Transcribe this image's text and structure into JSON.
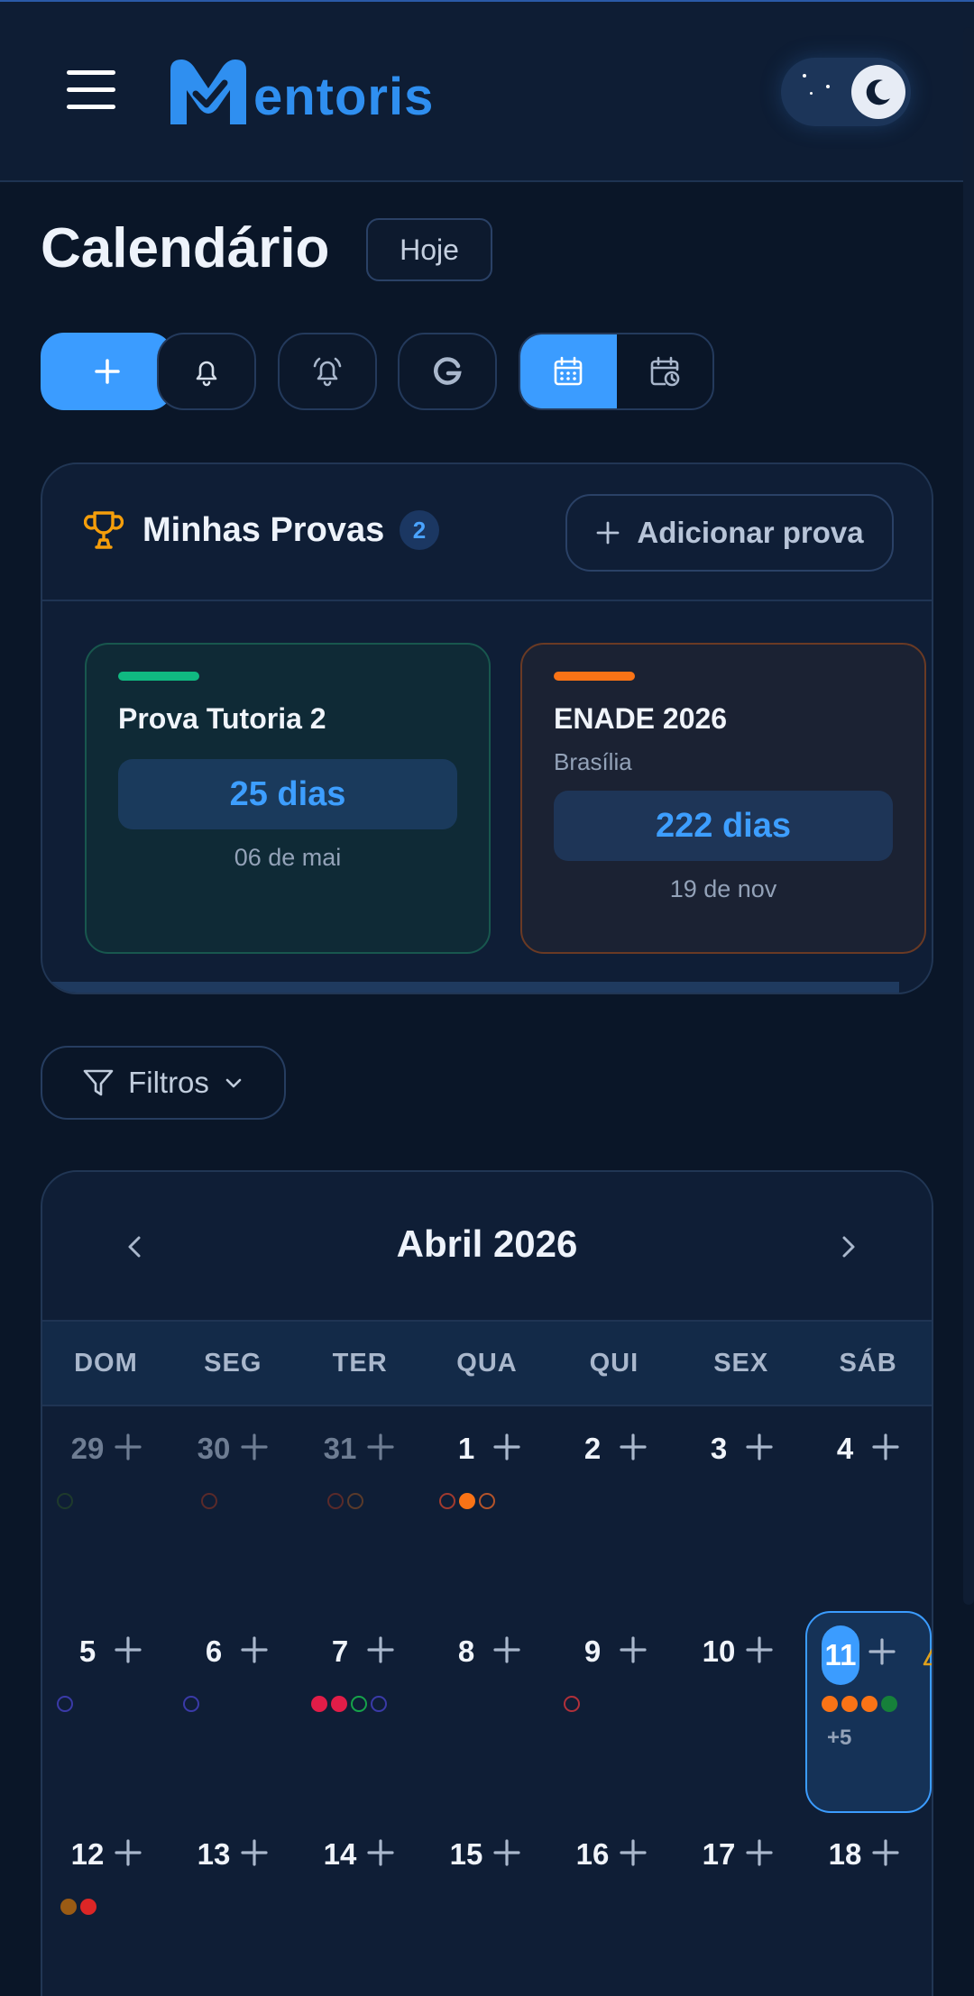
{
  "app": {
    "logo_text": "entoris",
    "logo_brand": "Mentoris",
    "accent_color": "#3b9cff"
  },
  "header": {
    "menu_icon": "hamburger-icon",
    "theme_icon": "moon-icon"
  },
  "page": {
    "title": "Calendário",
    "today_button": "Hoje"
  },
  "toolbar": [
    {
      "name": "add-event-button",
      "icon": "plus-icon"
    },
    {
      "name": "notifications-button",
      "icon": "bell-icon"
    },
    {
      "name": "alarms-button",
      "icon": "alarm-bell-icon"
    },
    {
      "name": "google-sync-button",
      "icon": "google-icon"
    },
    {
      "name": "calendar-view-button",
      "icon": "calendar-icon",
      "active": true
    },
    {
      "name": "schedule-view-button",
      "icon": "calendar-clock-icon",
      "active": false
    }
  ],
  "exams": {
    "title": "Minhas Provas",
    "count": "2",
    "add_label": "Adicionar prova",
    "items": [
      {
        "name": "Prova Tutoria 2",
        "location": "",
        "days": "25 dias",
        "date": "06 de mai",
        "color": "#10b981"
      },
      {
        "name": "ENADE 2026",
        "location": "Brasília",
        "days": "222 dias",
        "date": "19 de nov",
        "color": "#f97316"
      }
    ]
  },
  "filters": {
    "label": "Filtros"
  },
  "calendar": {
    "month": "Abril 2026",
    "weekdays": [
      "DOM",
      "SEG",
      "TER",
      "QUA",
      "QUI",
      "SEX",
      "SÁB"
    ],
    "days": [
      "29",
      "30",
      "31",
      "1",
      "2",
      "3",
      "4",
      "5",
      "6",
      "7",
      "8",
      "9",
      "10",
      "11",
      "12",
      "13",
      "14",
      "15",
      "16",
      "17",
      "18"
    ],
    "more_label": "+5"
  }
}
